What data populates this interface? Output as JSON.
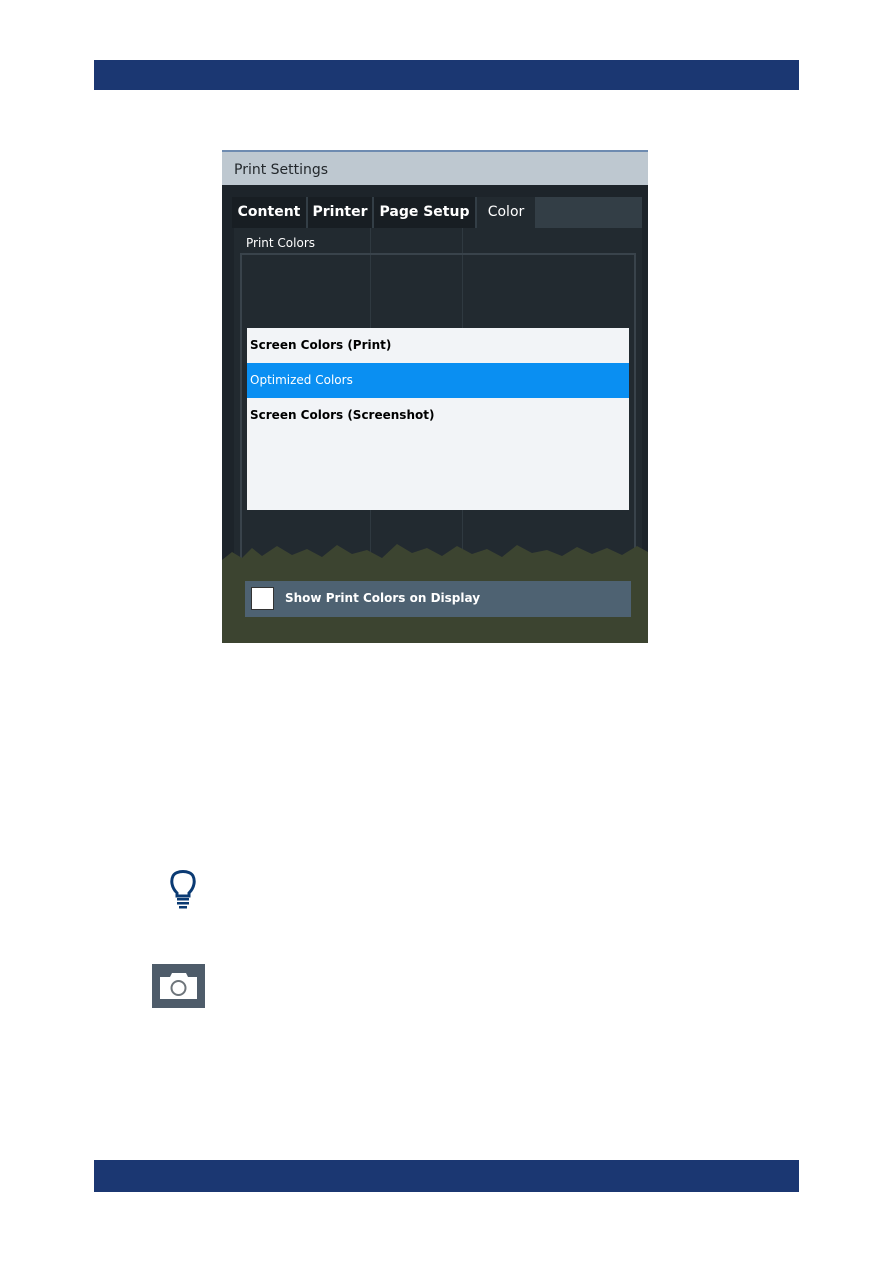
{
  "dialog": {
    "title": "Print Settings",
    "tabs": [
      {
        "label": "Content"
      },
      {
        "label": "Printer"
      },
      {
        "label": "Page Setup"
      },
      {
        "label": "Color",
        "active": true
      }
    ],
    "group_label": "Print Colors",
    "options": [
      {
        "label": "Screen Colors (Print)"
      },
      {
        "label": "Optimized Colors",
        "selected": true
      },
      {
        "label": "Screen Colors (Screenshot)"
      }
    ],
    "checkbox": {
      "label": "Show Print Colors on Display",
      "checked": false
    }
  },
  "colors": {
    "header_bar": "#1b3772",
    "selection": "#0a8ff2",
    "icon": "#0a3a73"
  },
  "icons": [
    "lightbulb-icon",
    "camera-icon"
  ]
}
